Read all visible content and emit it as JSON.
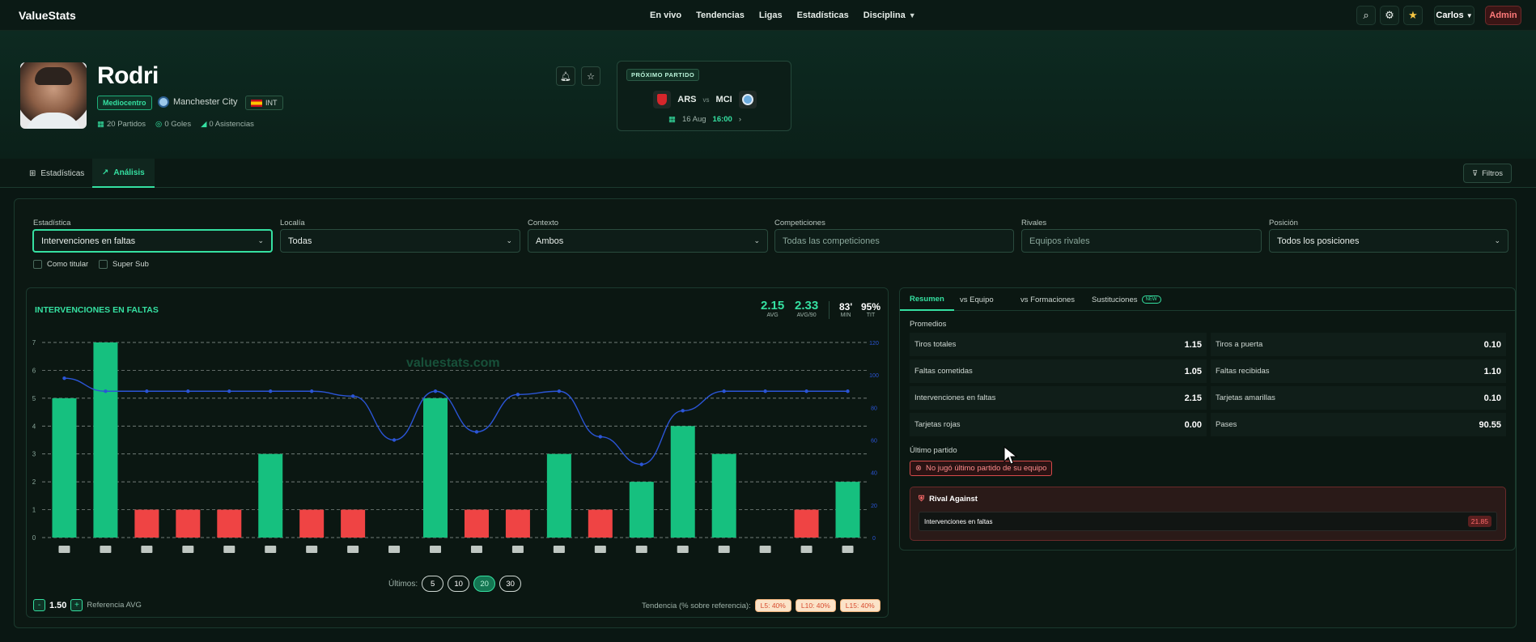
{
  "app": {
    "logo": "ValueStats"
  },
  "nav": {
    "items": [
      "En vivo",
      "Tendencias",
      "Ligas",
      "Estadísticas",
      "Disciplina"
    ],
    "user": "Carlos",
    "admin": "Admin"
  },
  "player": {
    "name": "Rodri",
    "position": "Mediocentro",
    "team": "Manchester City",
    "nationality": "INT",
    "stats": {
      "partidos": "20 Partidos",
      "goles": "0 Goles",
      "asistencias": "0 Asistencias"
    }
  },
  "next_match": {
    "label": "PRÓXIMO PARTIDO",
    "home": "ARS",
    "vs": "vs",
    "away": "MCI",
    "date": "16 Aug",
    "time": "16:00"
  },
  "tabs": [
    "Estadísticas",
    "Análisis"
  ],
  "filtros_label": "Filtros",
  "filters": {
    "estadistica": {
      "label": "Estadística",
      "value": "Intervenciones en faltas"
    },
    "localia": {
      "label": "Localía",
      "value": "Todas"
    },
    "contexto": {
      "label": "Contexto",
      "value": "Ambos"
    },
    "competiciones": {
      "label": "Competiciones",
      "placeholder": "Todas las competiciones"
    },
    "rivales": {
      "label": "Rivales",
      "placeholder": "Equipos rivales"
    },
    "posicion": {
      "label": "Posición",
      "value": "Todos los posiciones"
    },
    "como_titular": "Como titular",
    "super_sub": "Super Sub"
  },
  "chart": {
    "title": "INTERVENCIONES EN FALTAS",
    "avg": "2.15",
    "avg_label": "AVG",
    "avg90": "2.33",
    "avg90_label": "AVG/90",
    "min": "83'",
    "min_label": "MIN",
    "tit": "95%",
    "tit_label": "TIT",
    "watermark": "valuestats.com"
  },
  "chart_data": {
    "type": "bar",
    "categories": [
      "1",
      "2",
      "3",
      "4",
      "5",
      "6",
      "7",
      "8",
      "9",
      "10",
      "11",
      "12",
      "13",
      "14",
      "15",
      "16",
      "17",
      "18",
      "19",
      "20"
    ],
    "series": [
      {
        "values": [
          5,
          7,
          1,
          1,
          1,
          3,
          1,
          1,
          0,
          5,
          1,
          1,
          3,
          1,
          2,
          4,
          3,
          0,
          1,
          2
        ]
      },
      {
        "values": [
          98,
          90,
          90,
          90,
          90,
          90,
          90,
          87,
          60,
          90,
          65,
          88,
          90,
          62,
          45,
          78,
          90,
          90,
          90,
          90
        ]
      }
    ],
    "ylim": [
      0,
      7
    ],
    "y2lim": [
      0,
      120
    ],
    "yticks": [
      "0",
      "1",
      "2",
      "3",
      "4",
      "5",
      "6",
      "7"
    ],
    "y2ticks": [
      "0",
      "20",
      "40",
      "60",
      "80",
      "100",
      "120"
    ],
    "bar_colors": {
      "above": "#16c07f",
      "below": "#ef4444"
    },
    "line_color": "#2b55d6",
    "reference": 1.5,
    "grid": true
  },
  "ultimos": {
    "label": "Últimos:",
    "options": [
      "5",
      "10",
      "20",
      "30"
    ],
    "selected": "20"
  },
  "reference": {
    "minus": "-",
    "value": "1.50",
    "plus": "+",
    "label": "Referencia AVG"
  },
  "tendencia": {
    "label": "Tendencia (% sobre referencia):",
    "l5": "L5: 40%",
    "l10": "L10: 40%",
    "l15": "L15: 40%"
  },
  "right": {
    "tabs": [
      "Resumen",
      "vs Equipo",
      "vs Formaciones",
      "Sustituciones"
    ],
    "new_badge": "NEW",
    "promedios": "Promedios",
    "rows": [
      {
        "l": "Tiros totales",
        "v": "1.15",
        "l2": "Tiros a puerta",
        "v2": "0.10"
      },
      {
        "l": "Faltas cometidas",
        "v": "1.05",
        "l2": "Faltas recibidas",
        "v2": "1.10"
      },
      {
        "l": "Intervenciones en faltas",
        "v": "2.15",
        "l2": "Tarjetas amarillas",
        "v2": "0.10"
      },
      {
        "l": "Tarjetas rojas",
        "v": "0.00",
        "l2": "Pases",
        "v2": "90.55"
      }
    ],
    "ultimo_partido": "Último partido",
    "no_jugo": "No jugó último partido de su equipo",
    "rival_title": "Rival Against",
    "rival_stat": "Intervenciones en faltas",
    "rival_value": "21.85"
  },
  "colors": {
    "accent": "#35e0a1",
    "bar_green": "#16c07f",
    "bar_red": "#ef4444",
    "line": "#2b55d6"
  }
}
